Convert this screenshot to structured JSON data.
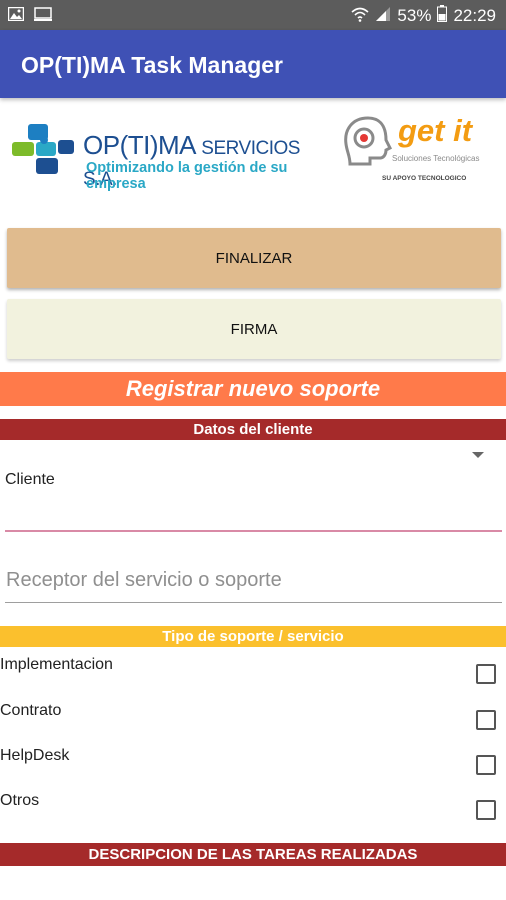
{
  "status_bar": {
    "left_icons": [
      "image-icon",
      "monitor-icon"
    ],
    "right_icons": [
      "wifi-icon",
      "signal-icon"
    ],
    "battery": "53%",
    "time": "22:29"
  },
  "app_bar": {
    "title": "OP(TI)MA Task Manager"
  },
  "logos": {
    "optima_name": "OP(TI)MA",
    "optima_suffix": "SERVICIOS S.A.",
    "optima_tagline": "Optimizando la gestión de su empresa",
    "getit_name": "get it",
    "getit_sub": "Soluciones Tecnológicas",
    "getit_apoyo": "SU APOYO TECNOLOGICO"
  },
  "buttons": {
    "finalizar": "FINALIZAR",
    "firma": "FIRMA"
  },
  "banner": {
    "title": "Registrar nuevo soporte"
  },
  "datos_cliente": {
    "header": "Datos del cliente",
    "cliente_label": "Cliente",
    "receptor_placeholder": "Receptor del servicio o soporte"
  },
  "tipo_soporte": {
    "header": "Tipo de soporte / servicio",
    "options": [
      {
        "label": "Implementacion",
        "checked": false
      },
      {
        "label": "Contrato",
        "checked": false
      },
      {
        "label": "HelpDesk",
        "checked": false
      },
      {
        "label": "Otros",
        "checked": false
      }
    ]
  },
  "descripcion": {
    "header": "DESCRIPCION DE LAS TAREAS REALIZADAS"
  },
  "colors": {
    "app_bar": "#3f51b5",
    "finalizar": "#e0bb8e",
    "firma": "#f2f2de",
    "banner": "#ff7a4a",
    "section_dark": "#a52a2a",
    "section_yellow": "#fbc02d"
  }
}
